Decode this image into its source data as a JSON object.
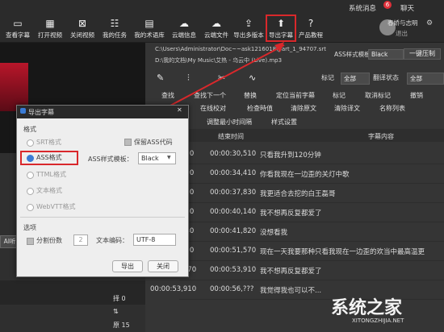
{
  "topbar": {
    "system_msg": "系统消息",
    "badge": "6",
    "chat": "聊天"
  },
  "toolbar": {
    "items": [
      {
        "label": "查看字幕",
        "icon": "view-subtitle-icon"
      },
      {
        "label": "打开视频",
        "icon": "open-video-icon"
      },
      {
        "label": "关闭视频",
        "icon": "close-video-icon"
      },
      {
        "label": "我的任务",
        "icon": "task-icon"
      },
      {
        "label": "我的术语库",
        "icon": "glossary-icon"
      },
      {
        "label": "云端信息",
        "icon": "cloud-info-icon"
      },
      {
        "label": "云端文件",
        "icon": "cloud-file-icon"
      },
      {
        "label": "导出多版本",
        "icon": "export-multi-icon"
      },
      {
        "label": "导出字幕",
        "icon": "export-subtitle-icon"
      },
      {
        "label": "产品教程",
        "icon": "help-icon"
      }
    ],
    "user": "春娇与志明",
    "logout": "退出"
  },
  "paths": {
    "line1": "C:\\Users\\Administrator\\Doc~~ask1216018\\part_1_94707.srt",
    "line2": "D:\\我的文档\\My Music\\艾热 - 乌云中 (Live).mp3"
  },
  "style": {
    "label": "ASS样式模板",
    "value": "Black",
    "button": "一键压制"
  },
  "filters": {
    "mark_label": "标记",
    "mark_value": "全部",
    "trans_label": "翻译状态",
    "trans_value": "全部"
  },
  "tools": {
    "row1": [
      "查找",
      "查找下一个",
      "替换",
      "定位当前字幕",
      "标记",
      "取消标记",
      "撤销"
    ],
    "row2": [
      "在线校对",
      "检查時值",
      "清除原文",
      "清除译文",
      "名称列表"
    ],
    "row3": [
      "调整最小时间隔",
      "样式设置"
    ]
  },
  "table": {
    "headers": {
      "end": "结束时间",
      "content": "字幕内容"
    },
    "rows": [
      {
        "start": "570",
        "end": "00:00:30,510",
        "text": "只看我升到120分钟"
      },
      {
        "start": "510",
        "end": "00:00:34,410",
        "text": "你看我现在一边歪的关灯中歌"
      },
      {
        "start": "410",
        "end": "00:00:37,830",
        "text": "我更适合去挖的白王磊哥"
      },
      {
        "start": "830",
        "end": "00:00:40,140",
        "text": "我不想再反复都爱了"
      },
      {
        "start": "140",
        "end": "00:00:41,820",
        "text": "没想看我"
      },
      {
        "start": "820",
        "end": "00:00:51,570",
        "text": "现在一天我要那种只看我现在一边歪的欢当中最高温更"
      },
      {
        "start": "00:00:51,570",
        "end": "00:00:53,910",
        "text": "我不想再反复都爱了"
      },
      {
        "start": "00:00:53,910",
        "end": "00:00:56,???",
        "text": "我觉得我也可以不..."
      }
    ]
  },
  "left": {
    "ai_tag": "AI听",
    "label1": "择 0",
    "label2": "原 15"
  },
  "dialog": {
    "title": "导出字幕",
    "format_label": "格式",
    "formats": [
      "SRT格式",
      "ASS格式",
      "TTML格式",
      "文本格式",
      "WebVTT格式"
    ],
    "selected_format": "ASS格式",
    "keep_ass": "保留ASS代码",
    "ass_template_label": "ASS样式模板：",
    "ass_template_value": "Black",
    "options_label": "选项",
    "split_label": "分割份数",
    "split_value": "2",
    "encoding_label": "文本编码：",
    "encoding_value": "UTF-8",
    "export_btn": "导出",
    "close_btn": "关闭"
  },
  "watermark": {
    "text": "系统之家",
    "url": "XITONGZHIJIA.NET"
  }
}
